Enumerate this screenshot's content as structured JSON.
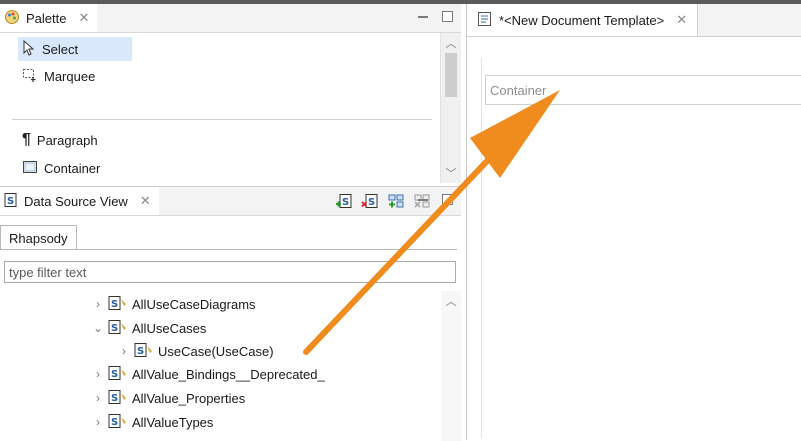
{
  "palette": {
    "title": "Palette",
    "items": [
      {
        "label": "Select",
        "icon": "cursor-icon",
        "selected": true
      },
      {
        "label": "Marquee",
        "icon": "marquee-icon",
        "selected": false
      },
      {
        "label": "Paragraph",
        "icon": "pilcrow-icon",
        "selected": false
      },
      {
        "label": "Container",
        "icon": "container-icon",
        "selected": false
      }
    ]
  },
  "data_source": {
    "title": "Data Source View",
    "tab": "Rhapsody",
    "filter_placeholder": "type filter text",
    "tree": [
      {
        "label": "AllUseCaseDiagrams",
        "expanded": false,
        "depth": 0
      },
      {
        "label": "AllUseCases",
        "expanded": true,
        "depth": 0
      },
      {
        "label": "UseCase(UseCase)",
        "expanded": false,
        "depth": 1
      },
      {
        "label": "AllValue_Bindings__Deprecated_",
        "expanded": false,
        "depth": 0
      },
      {
        "label": "AllValue_Properties",
        "expanded": false,
        "depth": 0
      },
      {
        "label": "AllValueTypes",
        "expanded": false,
        "depth": 0
      }
    ]
  },
  "editor": {
    "tab_title": "*<New Document Template>",
    "container_label": "Container"
  },
  "colors": {
    "selection": "#d9e8fb",
    "arrow": "#f08c1e",
    "panel_bg": "#f3f3f3"
  }
}
